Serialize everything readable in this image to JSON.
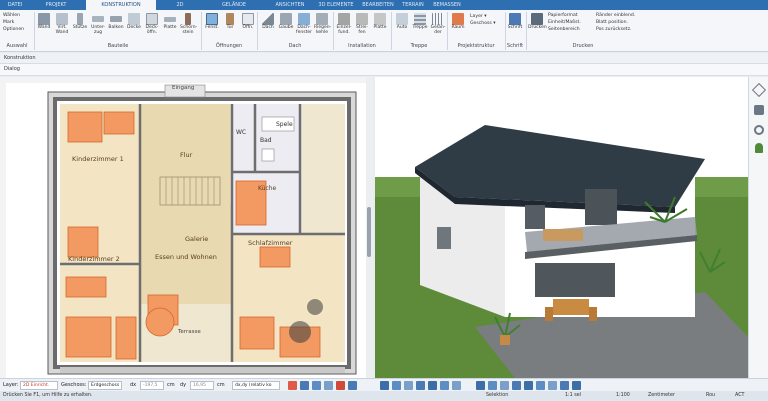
{
  "ribbon_tabs": [
    "DATEI",
    "PROJEKT",
    "KONSTRUKTION",
    "2D",
    "GELÄNDE",
    "ANSICHTEN",
    "3D ELEMENTE",
    "BEARBEITEN",
    "TERRAIN",
    "BEMASSEN"
  ],
  "quick": {
    "select": "Wählen",
    "mark": "Mark",
    "options": "Optionen",
    "group": "Auswahl"
  },
  "groups": {
    "bauteile": "Bauteile",
    "oeffnungen": "Öffnungen",
    "dach": "Dach",
    "installation": "Installation",
    "treppe": "Treppe",
    "projektstruktur": "Projektstruktur",
    "schrift": "Schrift",
    "drucken": "Drucken"
  },
  "buttons": {
    "wand": "Wand",
    "virt_wand": "Virt. Wand",
    "stuetze": "Stütze",
    "unterzug": "Unter- zug",
    "balken": "Balken",
    "decke": "Decke",
    "deckoeff": "Deck- öffn.",
    "platte": "Platte",
    "schornstein": "Schorn- stein",
    "fenster": "Fenst.",
    "tuer": "Tür",
    "oeffn": "Öffn.",
    "dach": "Dach",
    "gaube": "Gaube",
    "dachfenster": "Dach- fenster",
    "bagenkehle": "Riegen- kehle",
    "einzelfund": "Einzel- fund.",
    "streifenfund": "Strei- fen",
    "platte2": "Platte",
    "auto": "Auto",
    "treppe": "Treppe",
    "gelaender": "Gelän- der",
    "raum": "Raum",
    "schrift": "Schrift",
    "drucken": "Drucken"
  },
  "layer": {
    "layer_label": "Layer ▾",
    "geschoss_label": "Geschoss ▾"
  },
  "print_opts": [
    "Papierformat",
    "Einheit/Maßst.",
    "Seitenbereich",
    "Ränder einblend.",
    "Blatt position.",
    "Pos zurücksetz."
  ],
  "toolbar2": {
    "konstruktion": "Konstruktion"
  },
  "toolbar3": {
    "dialog": "Dialog"
  },
  "rooms": {
    "kinderzimmer1": "Kinderzimmer 1",
    "flur": "Flur",
    "wc": "WC",
    "bad": "Bad",
    "spele": "Spele",
    "kueche": "Küche",
    "galerie": "Galerie",
    "essen": "Essen und Wohnen",
    "kinderzimmer2": "Kinderzimmer 2",
    "schlafzimmer": "Schlafzimmer",
    "eingang": "Eingang",
    "terrasse": "Terrasse"
  },
  "status": {
    "layer_label": "Layer:",
    "layer_value": "2D Einricht.",
    "geschoss_label": "Geschoss:",
    "geschoss_value": "Erdgeschoss",
    "dx": "dx",
    "dy": "dy",
    "cm1": "cm",
    "cm2": "cm",
    "dxdy": "dx,dy (relativ ko",
    "dx_val": "-197,5",
    "dy_val": "16,95"
  },
  "status2": {
    "hint": "Drücken Sie F1, um Hilfe zu erhalten.",
    "selektion": "Selektion",
    "sel_count": "1:1 sel",
    "scale": "1:100",
    "zoom": "Zentimeter",
    "misc1": "Rou",
    "misc2": "ACT"
  },
  "colors": {
    "tabbar": "#2e6fb1",
    "ribbon": "#f4f6f9",
    "wall": "#8f8f8f",
    "furniture": "#f08a4b",
    "floor": "#e8d9b0",
    "roof": "#2f3b45",
    "grass": "#5e8b3a"
  }
}
